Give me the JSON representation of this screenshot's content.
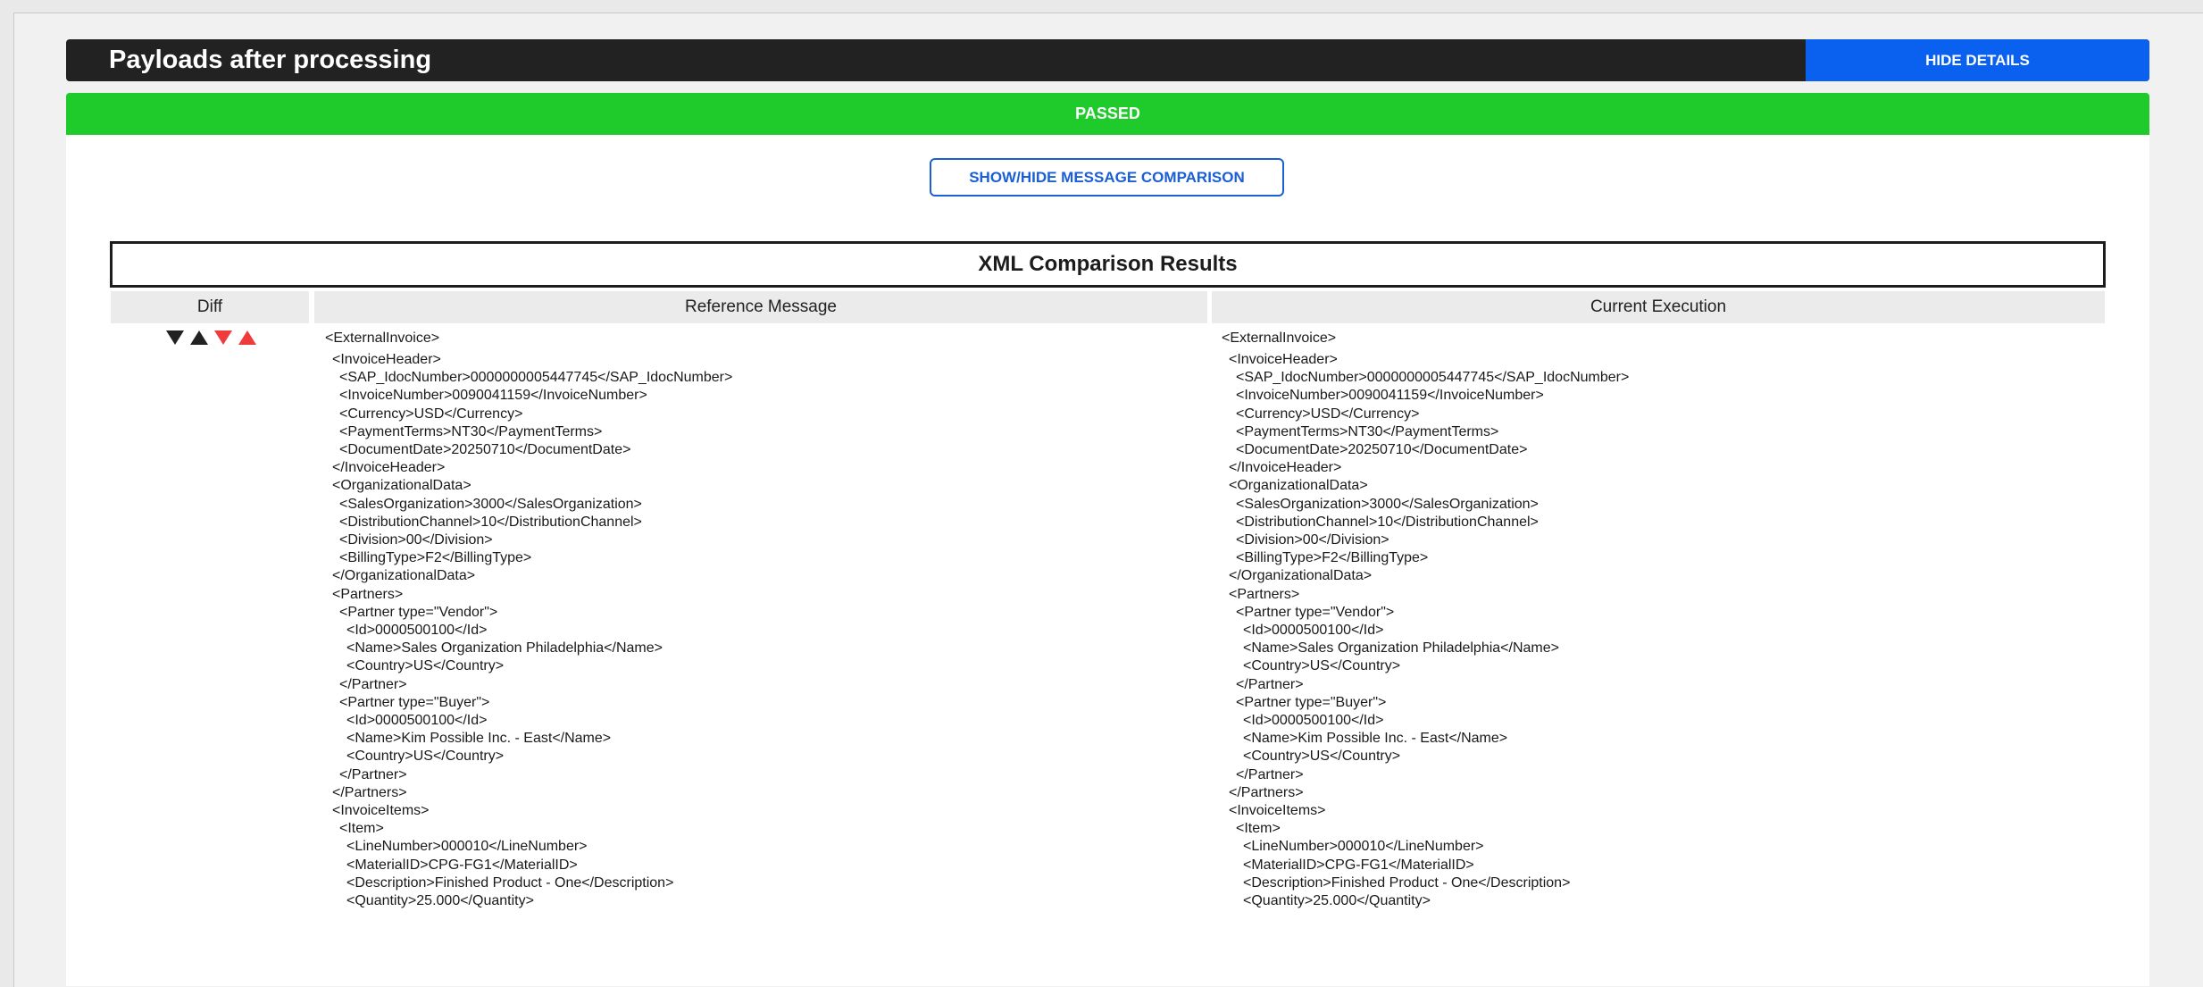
{
  "header": {
    "title": "Payloads after processing",
    "hide_details_label": "HIDE DETAILS"
  },
  "status": {
    "label": "PASSED",
    "color": "#1ecb2a"
  },
  "comparison": {
    "toggle_label": "SHOW/HIDE MESSAGE COMPARISON",
    "title": "XML Comparison Results",
    "columns": {
      "diff": "Diff",
      "reference": "Reference Message",
      "current": "Current Execution"
    },
    "diff_controls": [
      "next-diff-icon",
      "previous-diff-icon",
      "next-change-icon",
      "previous-change-icon"
    ]
  },
  "xml": {
    "reference": [
      {
        "text": "<ExternalInvoice>",
        "depth": 0
      },
      {
        "text": "<InvoiceHeader>",
        "depth": 1
      },
      {
        "text": "<SAP_IdocNumber>0000000005447745</SAP_IdocNumber>",
        "depth": 2
      },
      {
        "text": "<InvoiceNumber>0090041159</InvoiceNumber>",
        "depth": 2
      },
      {
        "text": "<Currency>USD</Currency>",
        "depth": 2
      },
      {
        "text": "<PaymentTerms>NT30</PaymentTerms>",
        "depth": 2
      },
      {
        "text": "<DocumentDate>20250710</DocumentDate>",
        "depth": 2
      },
      {
        "text": "</InvoiceHeader>",
        "depth": 1
      },
      {
        "text": "<OrganizationalData>",
        "depth": 1
      },
      {
        "text": "<SalesOrganization>3000</SalesOrganization>",
        "depth": 2
      },
      {
        "text": "<DistributionChannel>10</DistributionChannel>",
        "depth": 2
      },
      {
        "text": "<Division>00</Division>",
        "depth": 2
      },
      {
        "text": "<BillingType>F2</BillingType>",
        "depth": 2
      },
      {
        "text": "</OrganizationalData>",
        "depth": 1
      },
      {
        "text": "<Partners>",
        "depth": 1
      },
      {
        "text": "<Partner type=\"Vendor\">",
        "depth": 2
      },
      {
        "text": "<Id>0000500100</Id>",
        "depth": 3
      },
      {
        "text": "<Name>Sales Organization Philadelphia</Name>",
        "depth": 3
      },
      {
        "text": "<Country>US</Country>",
        "depth": 3
      },
      {
        "text": "</Partner>",
        "depth": 2
      },
      {
        "text": "<Partner type=\"Buyer\">",
        "depth": 2
      },
      {
        "text": "<Id>0000500100</Id>",
        "depth": 3
      },
      {
        "text": "<Name>Kim Possible Inc. - East</Name>",
        "depth": 3
      },
      {
        "text": "<Country>US</Country>",
        "depth": 3
      },
      {
        "text": "</Partner>",
        "depth": 2
      },
      {
        "text": "</Partners>",
        "depth": 1
      },
      {
        "text": "<InvoiceItems>",
        "depth": 1
      },
      {
        "text": "<Item>",
        "depth": 2
      },
      {
        "text": "<LineNumber>000010</LineNumber>",
        "depth": 3
      },
      {
        "text": "<MaterialID>CPG-FG1</MaterialID>",
        "depth": 3
      },
      {
        "text": "<Description>Finished Product - One</Description>",
        "depth": 3
      },
      {
        "text": "<Quantity>25.000</Quantity>",
        "depth": 3
      }
    ],
    "current": [
      {
        "text": "<ExternalInvoice>",
        "depth": 0
      },
      {
        "text": "<InvoiceHeader>",
        "depth": 1
      },
      {
        "text": "<SAP_IdocNumber>0000000005447745</SAP_IdocNumber>",
        "depth": 2
      },
      {
        "text": "<InvoiceNumber>0090041159</InvoiceNumber>",
        "depth": 2
      },
      {
        "text": "<Currency>USD</Currency>",
        "depth": 2
      },
      {
        "text": "<PaymentTerms>NT30</PaymentTerms>",
        "depth": 2
      },
      {
        "text": "<DocumentDate>20250710</DocumentDate>",
        "depth": 2
      },
      {
        "text": "</InvoiceHeader>",
        "depth": 1
      },
      {
        "text": "<OrganizationalData>",
        "depth": 1
      },
      {
        "text": "<SalesOrganization>3000</SalesOrganization>",
        "depth": 2
      },
      {
        "text": "<DistributionChannel>10</DistributionChannel>",
        "depth": 2
      },
      {
        "text": "<Division>00</Division>",
        "depth": 2
      },
      {
        "text": "<BillingType>F2</BillingType>",
        "depth": 2
      },
      {
        "text": "</OrganizationalData>",
        "depth": 1
      },
      {
        "text": "<Partners>",
        "depth": 1
      },
      {
        "text": "<Partner type=\"Vendor\">",
        "depth": 2
      },
      {
        "text": "<Id>0000500100</Id>",
        "depth": 3
      },
      {
        "text": "<Name>Sales Organization Philadelphia</Name>",
        "depth": 3
      },
      {
        "text": "<Country>US</Country>",
        "depth": 3
      },
      {
        "text": "</Partner>",
        "depth": 2
      },
      {
        "text": "<Partner type=\"Buyer\">",
        "depth": 2
      },
      {
        "text": "<Id>0000500100</Id>",
        "depth": 3
      },
      {
        "text": "<Name>Kim Possible Inc. - East</Name>",
        "depth": 3
      },
      {
        "text": "<Country>US</Country>",
        "depth": 3
      },
      {
        "text": "</Partner>",
        "depth": 2
      },
      {
        "text": "</Partners>",
        "depth": 1
      },
      {
        "text": "<InvoiceItems>",
        "depth": 1
      },
      {
        "text": "<Item>",
        "depth": 2
      },
      {
        "text": "<LineNumber>000010</LineNumber>",
        "depth": 3
      },
      {
        "text": "<MaterialID>CPG-FG1</MaterialID>",
        "depth": 3
      },
      {
        "text": "<Description>Finished Product - One</Description>",
        "depth": 3
      },
      {
        "text": "<Quantity>25.000</Quantity>",
        "depth": 3
      }
    ]
  }
}
